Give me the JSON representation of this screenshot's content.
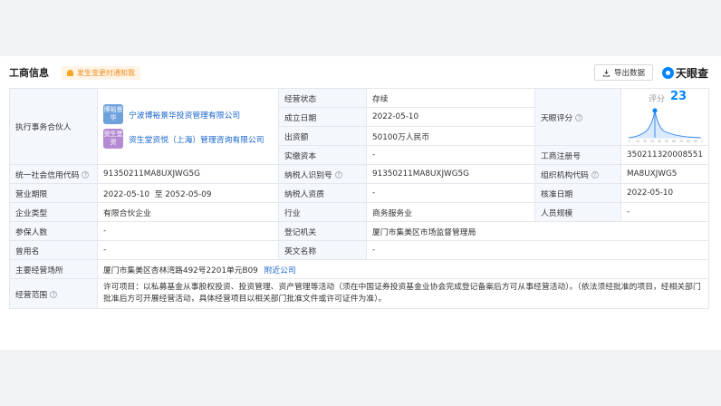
{
  "header": {
    "title": "工商信息",
    "notify_label": "发生变更时通知我",
    "export_label": "导出数据",
    "brand": "天眼查"
  },
  "rows": {
    "partner_label": "执行事务合伙人",
    "partners": [
      {
        "avatar": "博裕景华",
        "name": "宁波博裕景华投资管理有限公司"
      },
      {
        "avatar": "资生堂资",
        "name": "资生堂资悦（上海）管理咨询有限公司"
      }
    ],
    "status_label": "经营状态",
    "status_value": "存续",
    "founded_label": "成立日期",
    "founded_value": "2022-05-10",
    "capital_label": "出资额",
    "capital_value": "50100万人民币",
    "paid_label": "实缴资本",
    "paid_value": "-",
    "score_label": "天眼评分",
    "score_text": "评分",
    "score_value": "23",
    "score_ticks": [
      "0",
      "10",
      "20",
      "30",
      "40",
      "50",
      "60",
      "70",
      "80",
      "90",
      "100"
    ],
    "regno_label": "工商注册号",
    "regno_value": "350211320008551",
    "credit_label": "统一社会信用代码",
    "credit_value": "91350211MA8UXJWG5G",
    "taxid_label": "纳税人识别号",
    "taxid_value": "91350211MA8UXJWG5G",
    "orgcode_label": "组织机构代码",
    "orgcode_value": "MA8UXJWG5",
    "term_label": "营业期限",
    "term_value": "2022-05-10  至 2052-05-09",
    "taxqual_label": "纳税人资质",
    "taxqual_value": "-",
    "approve_label": "核准日期",
    "approve_value": "2022-05-10",
    "type_label": "企业类型",
    "type_value": "有限合伙企业",
    "industry_label": "行业",
    "industry_value": "商务服务业",
    "staff_label": "人员规模",
    "staff_value": "-",
    "insured_label": "参保人数",
    "insured_value": "-",
    "authority_label": "登记机关",
    "authority_value": "厦门市集美区市场监督管理局",
    "former_label": "曾用名",
    "former_value": "-",
    "english_label": "英文名称",
    "english_value": "-",
    "address_label": "主要经营场所",
    "address_value": "厦门市集美区杏林湾路492号2201单元B09",
    "nearby_label": "附近公司",
    "scope_label": "经营范围",
    "scope_value": "许可项目：以私募基金从事股权投资、投资管理、资产管理等活动（须在中国证券投资基金业协会完成登记备案后方可从事经营活动）。（依法须经批准的项目，经相关部门批准后方可开展经营活动，具体经营项目以相关部门批准文件或许可证件为准）。"
  },
  "colors": {
    "accent": "#0084ff",
    "label_bg": "#f4f7fc",
    "link": "#1a66cc",
    "notify": "#f08c1e"
  }
}
